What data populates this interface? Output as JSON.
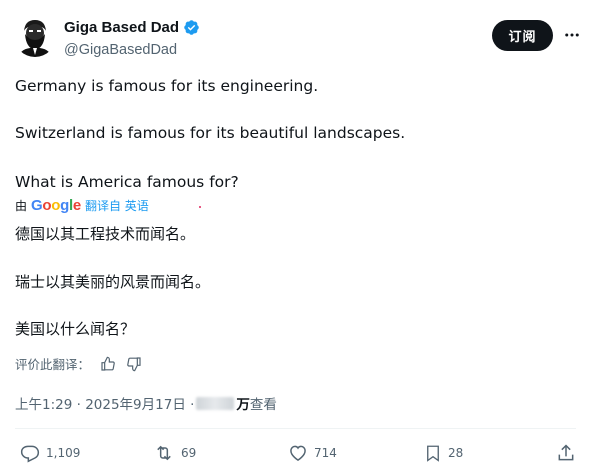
{
  "author": {
    "name": "Giga Based Dad",
    "handle": "@GigaBasedDad",
    "subscribe_label": "订阅"
  },
  "tweet": {
    "lines": [
      "Germany is famous for its engineering.",
      "Switzerland is famous for its beautiful landscapes.",
      "What is America famous for?"
    ]
  },
  "translation": {
    "by": "由",
    "provider": "Google",
    "source_label": "翻译自 英语",
    "lines": [
      "德国以其工程技术而闻名。",
      "瑞士以其美丽的风景而闻名。",
      "美国以什么闻名？"
    ],
    "rate_label": "评价此翻译："
  },
  "meta": {
    "time": "上午1:29 · 2025年9月17日 · ",
    "views_suffix": "万",
    "views_label": " 查看"
  },
  "actions": {
    "reply_count": "1,109",
    "retweet_count": "69",
    "like_count": "714",
    "bookmark_count": "28"
  },
  "colors": {
    "verified": "#1d9bf0",
    "text": "#0f1419",
    "muted": "#536471",
    "button_bg": "#0f1419"
  }
}
